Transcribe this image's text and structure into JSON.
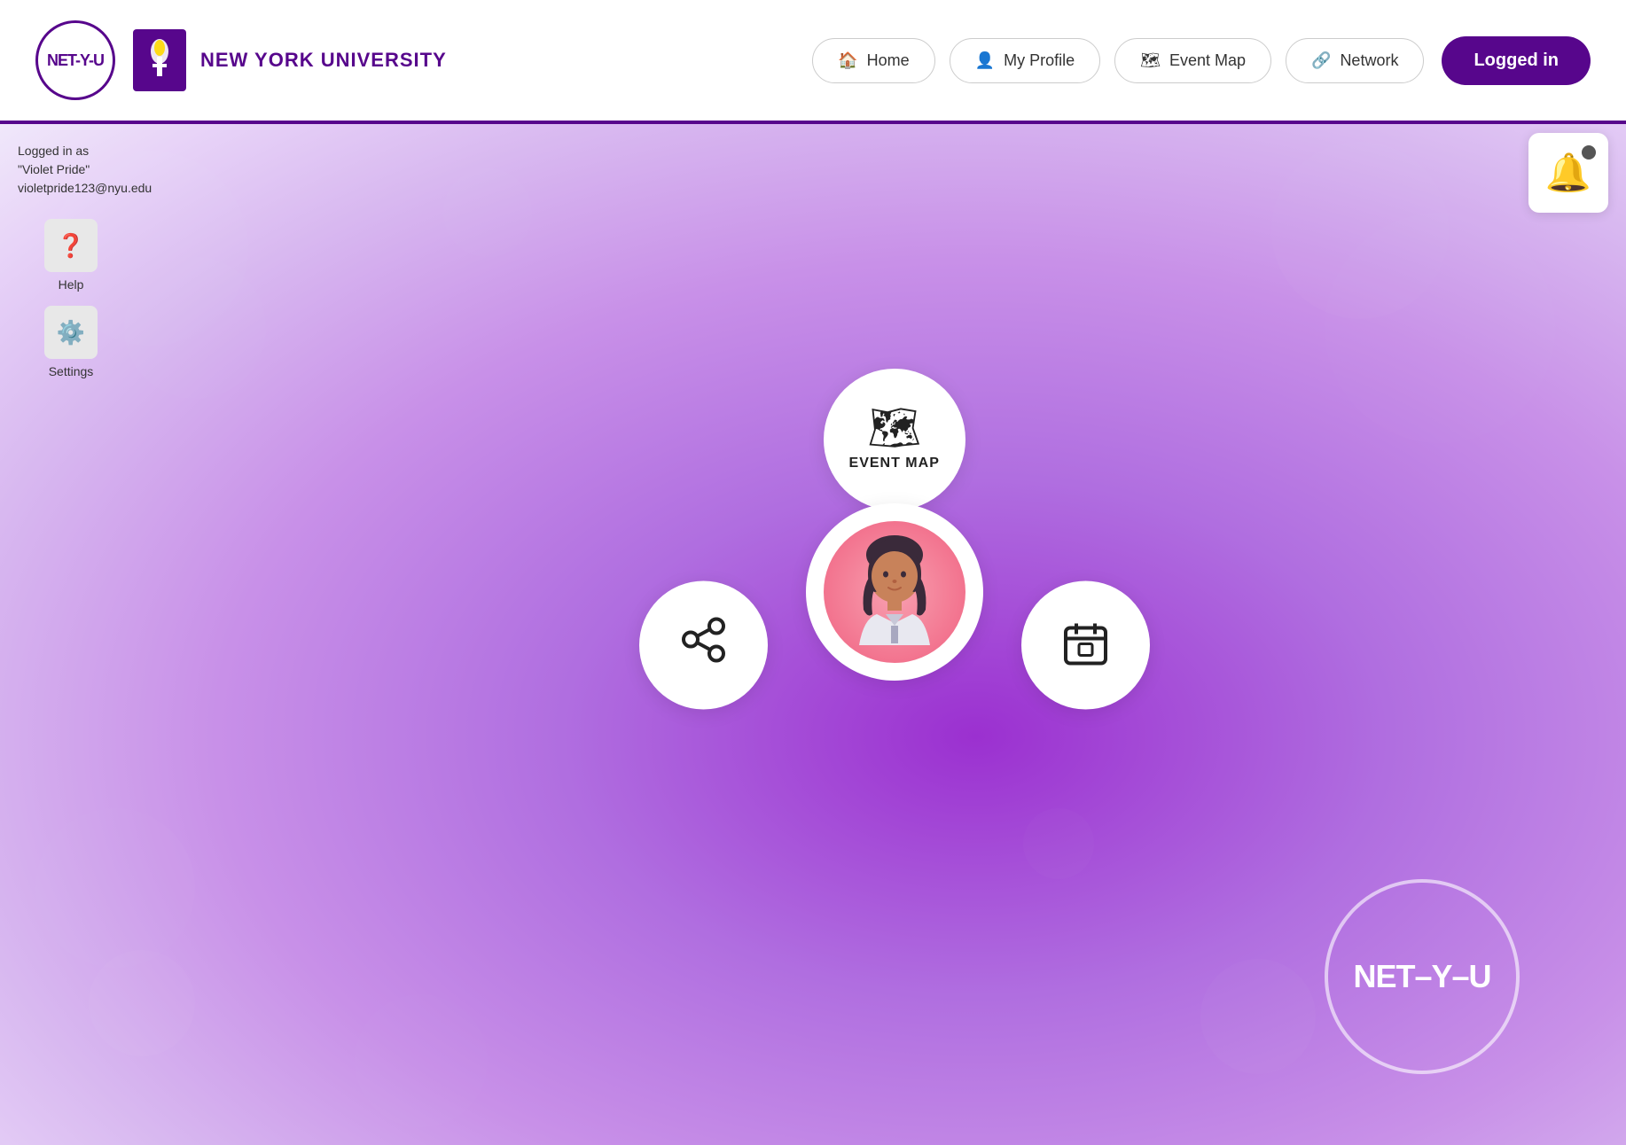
{
  "app": {
    "name": "NET-Y-U",
    "university": "NEW YORK UNIVERSITY"
  },
  "header": {
    "nav": [
      {
        "id": "home",
        "label": "Home",
        "icon": "🏠"
      },
      {
        "id": "my-profile",
        "label": "My Profile",
        "icon": "👤"
      },
      {
        "id": "event-map",
        "label": "Event Map",
        "icon": "🗺"
      },
      {
        "id": "network",
        "label": "Network",
        "icon": "🔗"
      }
    ],
    "cta_label": "Logged in"
  },
  "sidebar": {
    "user_logged_as": "Logged in as \"Violet Pride\"",
    "user_email": "violetpride123@nyu.edu",
    "items": [
      {
        "id": "help",
        "label": "Help",
        "icon": "❓"
      },
      {
        "id": "settings",
        "label": "Settings",
        "icon": "⚙️"
      }
    ]
  },
  "hub": {
    "event_map_label": "EVENT MAP",
    "share_label": "",
    "calendar_label": ""
  },
  "watermark": {
    "text": "NET–Y–U"
  },
  "notification": {
    "aria": "Notifications"
  }
}
